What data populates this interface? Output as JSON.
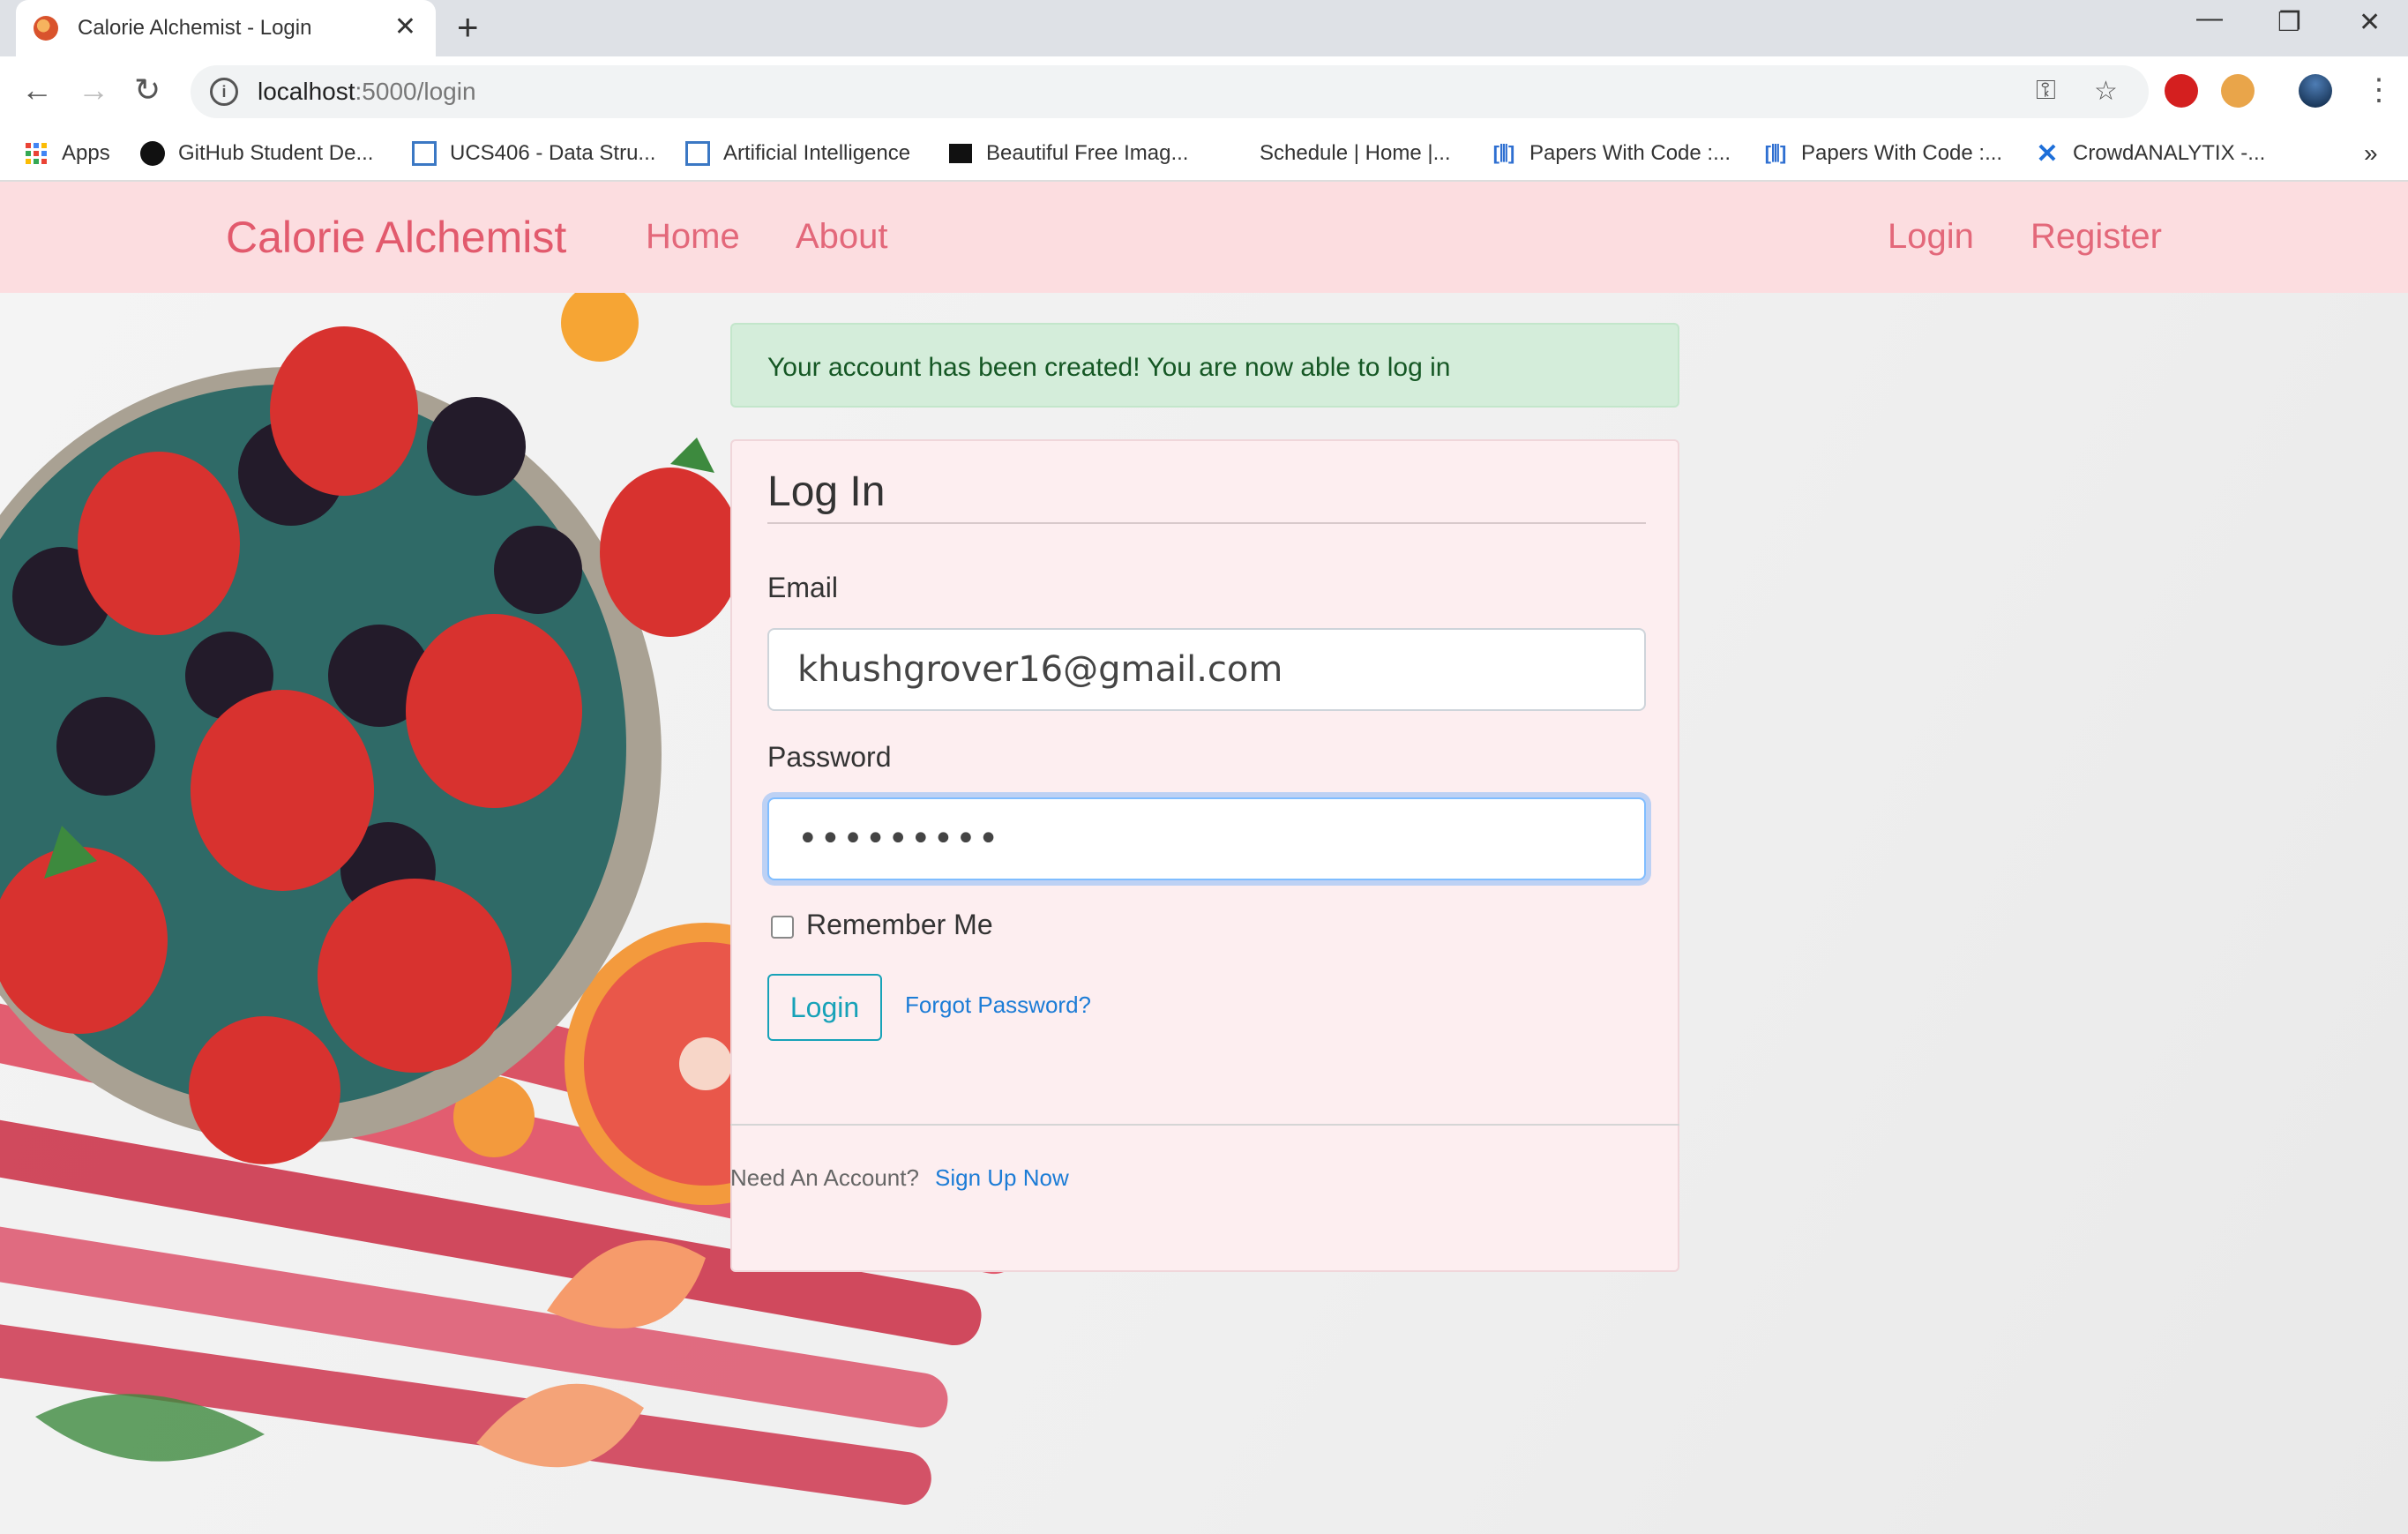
{
  "browser": {
    "tab_title": "Calorie Alchemist - Login",
    "url_host": "localhost",
    "url_path": ":5000/login",
    "bookmarks": [
      {
        "label": "Apps",
        "icon": "apps-grid-icon"
      },
      {
        "label": "GitHub Student De...",
        "icon": "github-icon"
      },
      {
        "label": "UCS406 - Data Stru...",
        "icon": "page-icon"
      },
      {
        "label": "Artificial Intelligence",
        "icon": "page-icon"
      },
      {
        "label": "Beautiful Free Imag...",
        "icon": "unsplash-icon"
      },
      {
        "label": "Schedule | Home |...",
        "icon": "none"
      },
      {
        "label": "Papers With Code :...",
        "icon": "paperswithcode-icon"
      },
      {
        "label": "Papers With Code :...",
        "icon": "paperswithcode-icon"
      },
      {
        "label": "CrowdANALYTIX -...",
        "icon": "crowdanalytix-icon"
      }
    ],
    "more_bookmarks": "»"
  },
  "navbar": {
    "brand": "Calorie Alchemist",
    "left_links": [
      "Home",
      "About"
    ],
    "right_links": [
      "Login",
      "Register"
    ]
  },
  "alert": {
    "message": "Your account has been created! You are now able to log in"
  },
  "form": {
    "legend": "Log In",
    "email_label": "Email",
    "email_value": "khushgrover16@gmail.com",
    "password_label": "Password",
    "password_value": "•••••••••",
    "remember_label": "Remember Me",
    "submit_label": "Login",
    "forgot_label": "Forgot Password?"
  },
  "footer": {
    "prompt": "Need An Account?",
    "signup_label": "Sign Up Now"
  },
  "colors": {
    "navbar_bg": "#fcdde0",
    "brand": "#e25a6d",
    "alert_bg": "#d4edda",
    "alert_text": "#155724",
    "card_bg": "#fdeef0",
    "button_outline": "#17a2b8",
    "link": "#1c7cd6"
  }
}
